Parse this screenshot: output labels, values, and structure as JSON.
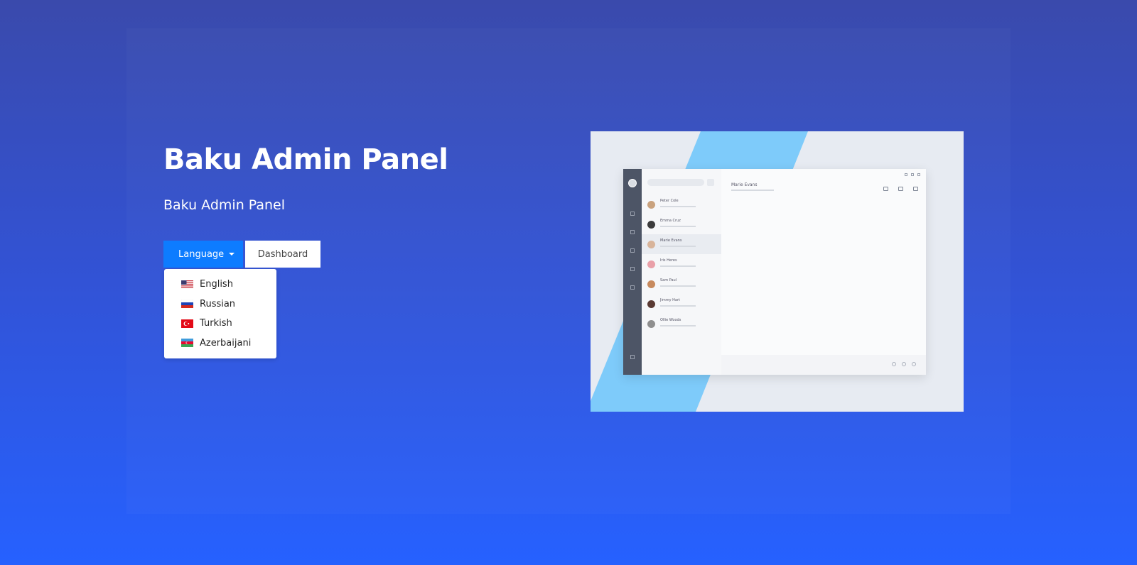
{
  "hero": {
    "title": "Baku Admin Panel",
    "subtitle": "Baku Admin Panel"
  },
  "buttons": {
    "language_label": "Language",
    "dashboard_label": "Dashboard"
  },
  "language_menu": {
    "items": [
      {
        "label": "English",
        "icon": "flag-us-icon"
      },
      {
        "label": "Russian",
        "icon": "flag-ru-icon"
      },
      {
        "label": "Turkish",
        "icon": "flag-tr-icon"
      },
      {
        "label": "Azerbaijani",
        "icon": "flag-az-icon"
      }
    ]
  },
  "preview": {
    "contacts": [
      {
        "name": "Peter Cole"
      },
      {
        "name": "Emma Cruz"
      },
      {
        "name": "Marie Evans"
      },
      {
        "name": "Iris Heres"
      },
      {
        "name": "Sam Paul"
      },
      {
        "name": "Jimmy Hart"
      },
      {
        "name": "Ollie Woods"
      }
    ],
    "chat_title": "Marie Evans"
  },
  "colors": {
    "primary_button": "#0d7cff",
    "background_top": "#3a4aac",
    "background_bottom": "#2661ff",
    "preview_accent": "#7ecbfa"
  }
}
